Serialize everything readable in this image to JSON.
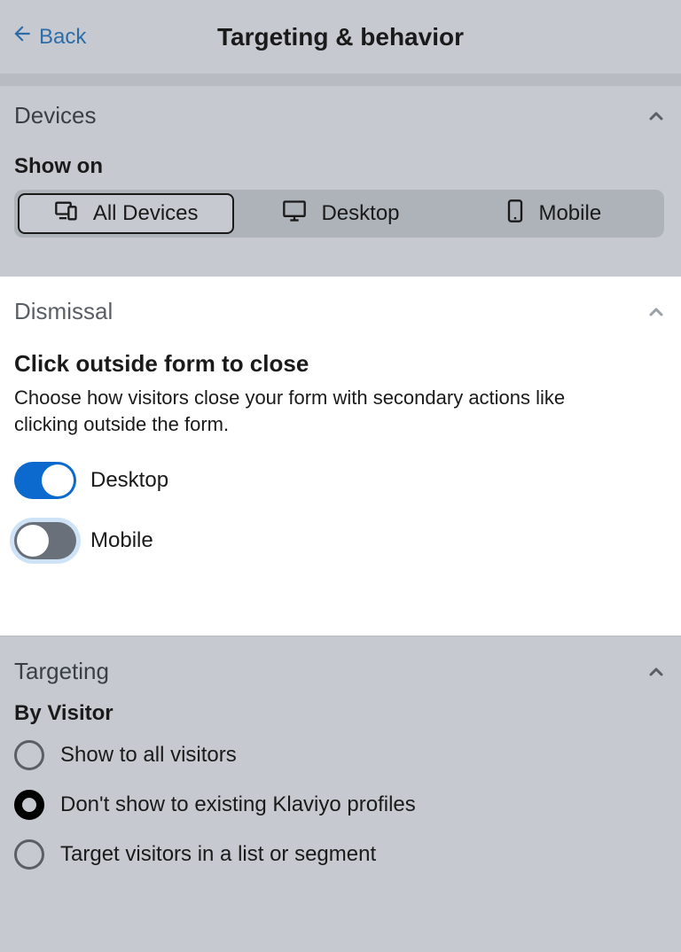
{
  "header": {
    "back_label": "Back",
    "title": "Targeting & behavior"
  },
  "devices": {
    "title": "Devices",
    "show_on_label": "Show on",
    "options": {
      "all": "All Devices",
      "desktop": "Desktop",
      "mobile": "Mobile"
    },
    "selected": "all"
  },
  "dismissal": {
    "title": "Dismissal",
    "heading": "Click outside form to close",
    "description": "Choose how visitors close your form with secondary actions like clicking outside the form.",
    "desktop": {
      "label": "Desktop",
      "value": true
    },
    "mobile": {
      "label": "Mobile",
      "value": false,
      "focused": true
    }
  },
  "targeting": {
    "title": "Targeting",
    "by_visitor_label": "By Visitor",
    "options": [
      {
        "label": "Show to all visitors"
      },
      {
        "label": "Don't show to existing Klaviyo profiles",
        "selected": true
      },
      {
        "label": "Target visitors in a list or segment"
      }
    ]
  }
}
